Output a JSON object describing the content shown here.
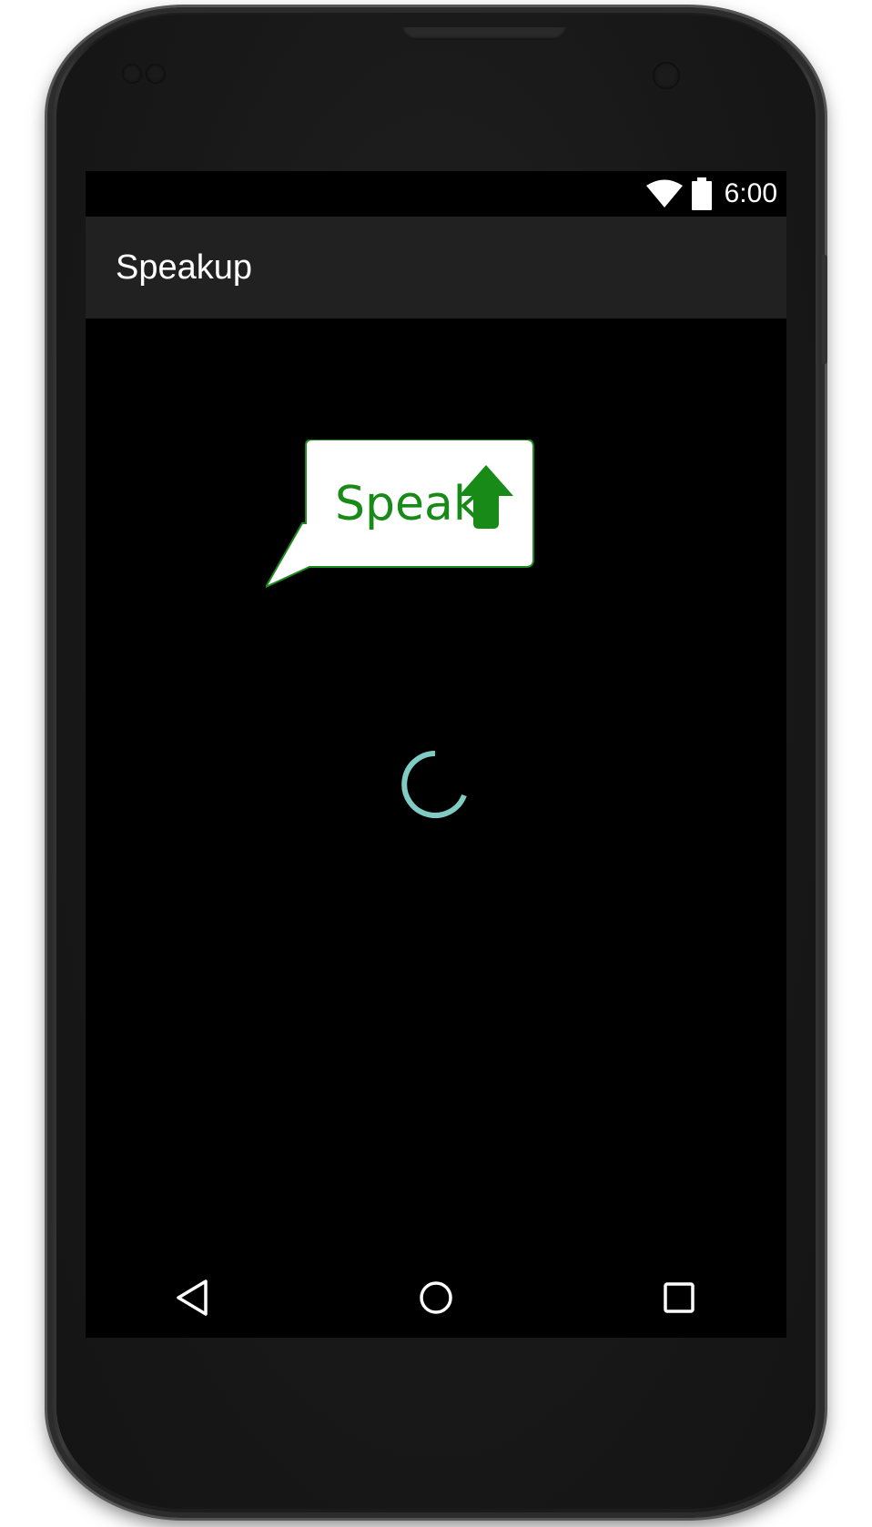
{
  "status_bar": {
    "time": "6:00",
    "icons": [
      "wifi-icon",
      "battery-icon"
    ]
  },
  "action_bar": {
    "title": "Speakup"
  },
  "logo": {
    "text": "Speak",
    "icon": "up-arrow-icon",
    "text_color": "#178a17",
    "bubble_color": "#ffffff"
  },
  "loading": {
    "icon": "progress-spinner",
    "color": "#80cbc4"
  },
  "nav_bar": {
    "buttons": [
      "back-button",
      "home-button",
      "recents-button"
    ]
  },
  "colors": {
    "screen_background": "#000000",
    "action_bar_background": "#212121",
    "text": "#ffffff"
  }
}
